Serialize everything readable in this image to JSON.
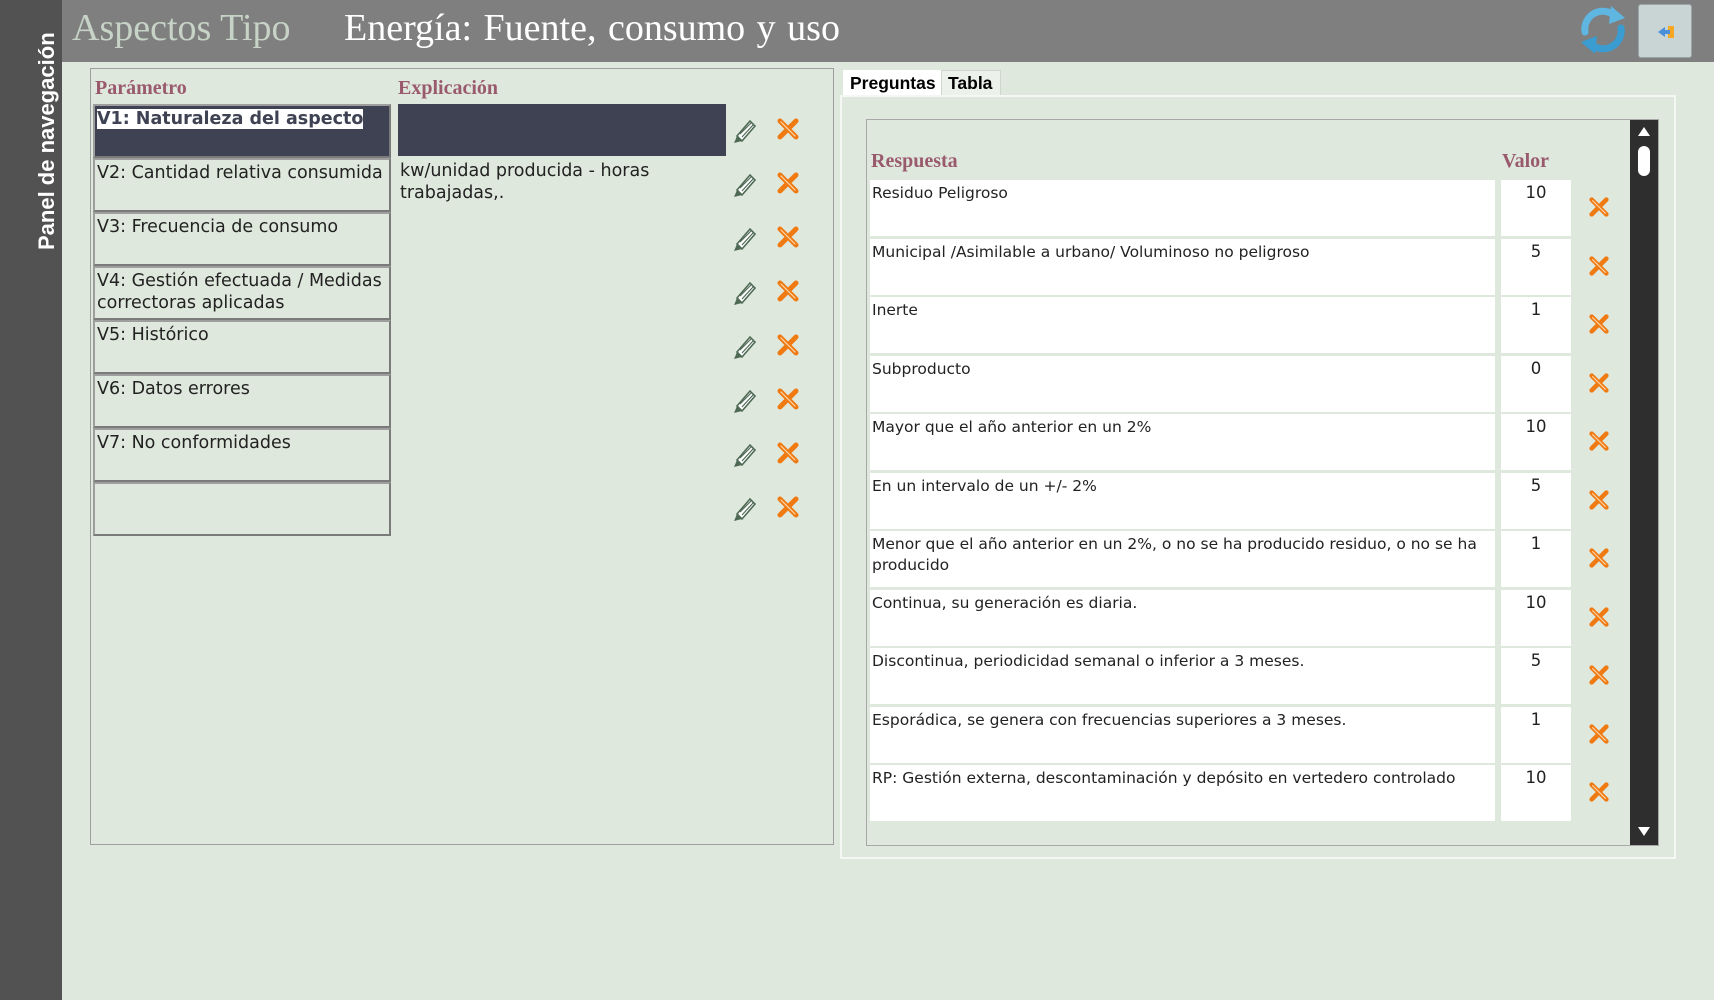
{
  "nav": {
    "label": "Panel de navegación"
  },
  "header": {
    "title_prefix": "Aspectos Tipo",
    "title_main": "Energía: Fuente, consumo y  uso",
    "refresh_icon": "refresh-icon",
    "exit_icon": "exit-arrow-icon"
  },
  "params": {
    "col_param": "Parámetro",
    "col_expl": "Explicación",
    "rows": [
      {
        "name": "V1: Naturaleza del aspecto",
        "explanation": ""
      },
      {
        "name": "V2: Cantidad relativa consumida",
        "explanation": "kw/unidad producida - horas trabajadas,."
      },
      {
        "name": "V3: Frecuencia de consumo",
        "explanation": ""
      },
      {
        "name": "V4: Gestión efectuada / Medidas correctoras aplicadas",
        "explanation": ""
      },
      {
        "name": "V5: Histórico",
        "explanation": ""
      },
      {
        "name": "V6: Datos errores",
        "explanation": ""
      },
      {
        "name": "V7: No conformidades",
        "explanation": ""
      },
      {
        "name": "",
        "explanation": ""
      }
    ],
    "selected_index": 0
  },
  "tabs": {
    "preguntas": "Preguntas",
    "tabla": "Tabla"
  },
  "answers": {
    "col_resp": "Respuesta",
    "col_valor": "Valor",
    "rows": [
      {
        "text": "Residuo Peligroso",
        "value": "10"
      },
      {
        "text": "Municipal /Asimilable a urbano/ Voluminoso no peligroso",
        "value": "5"
      },
      {
        "text": "Inerte",
        "value": "1"
      },
      {
        "text": "Subproducto",
        "value": "0"
      },
      {
        "text": "Mayor que el año anterior en un 2%",
        "value": "10"
      },
      {
        "text": "En un intervalo de un +/- 2%",
        "value": "5"
      },
      {
        "text": "Menor que el año anterior en un 2%, o no se ha producido residuo, o no se ha producido",
        "value": "1"
      },
      {
        "text": "Continua, su generación es diaria.",
        "value": "10"
      },
      {
        "text": "Discontinua, periodicidad semanal o inferior a 3 meses.",
        "value": "5"
      },
      {
        "text": "Esporádica, se genera con frecuencias superiores a 3 meses.",
        "value": "1"
      },
      {
        "text": "RP: Gestión externa, descontaminación y depósito en vertedero controlado",
        "value": "10"
      }
    ]
  },
  "colors": {
    "background": "#dfe8dc",
    "header": "#7f7f7f",
    "nav": "#525252",
    "heading_accent": "#9a5a6e",
    "selected_row": "#3e4252",
    "delete_icon": "#f07a12"
  }
}
